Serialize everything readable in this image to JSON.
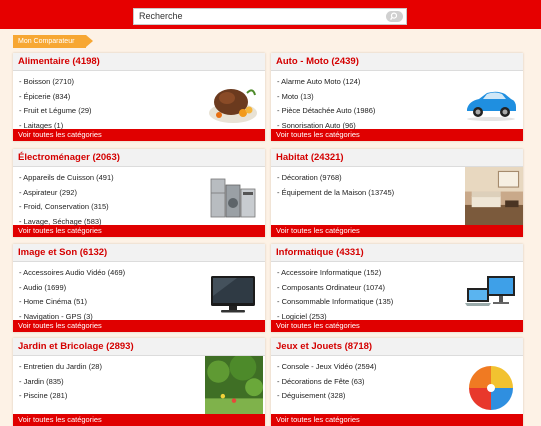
{
  "search": {
    "value": "Recherche"
  },
  "breadcrumb": "Mon Comparateur",
  "footer_link": "Voir toutes les catégories",
  "colors": {
    "accent": "#e00000",
    "title": "#d40000",
    "breadcrumb": "#f7a733"
  },
  "cards": [
    {
      "title": "Alimentaire (4198)",
      "image": "food-dish",
      "items": [
        "- Boisson (2710)",
        "- Épicerie (834)",
        "- Fruit et Légume (29)",
        "- Laitages (1)"
      ]
    },
    {
      "title": "Auto - Moto (2439)",
      "image": "blue-car",
      "items": [
        "- Alarme Auto Moto (124)",
        "- Moto (13)",
        "- Pièce Détachée Auto (1986)",
        "- Sonorisation Auto (96)"
      ]
    },
    {
      "title": "Électroménager (2063)",
      "image": "appliances",
      "items": [
        "- Appareils de Cuisson (491)",
        "- Aspirateur (292)",
        "- Froid, Conservation (315)",
        "- Lavage, Séchage (583)"
      ]
    },
    {
      "title": "Habitat (24321)",
      "image": "living-room",
      "items": [
        "- Décoration (9768)",
        "- Équipement de la Maison (13745)"
      ]
    },
    {
      "title": "Image et Son (6132)",
      "image": "television",
      "items": [
        "- Accessoires Audio Vidéo (469)",
        "- Audio (1699)",
        "- Home Cinéma (51)",
        "- Navigation - GPS (3)"
      ]
    },
    {
      "title": "Informatique (4331)",
      "image": "laptop-monitor",
      "items": [
        "- Accessoire Informatique (152)",
        "- Composants Ordinateur (1074)",
        "- Consommable Informatique (135)",
        "- Logiciel (253)"
      ]
    },
    {
      "title": "Jardin et Bricolage (2893)",
      "image": "garden",
      "items": [
        "- Entretien du Jardin (28)",
        "- Jardin (835)",
        "- Piscine (281)"
      ]
    },
    {
      "title": "Jeux et Jouets (8718)",
      "image": "beach-ball",
      "items": [
        "- Console - Jeux Vidéo (2594)",
        "- Décorations de Fête (63)",
        "- Déguisement (328)"
      ]
    }
  ]
}
